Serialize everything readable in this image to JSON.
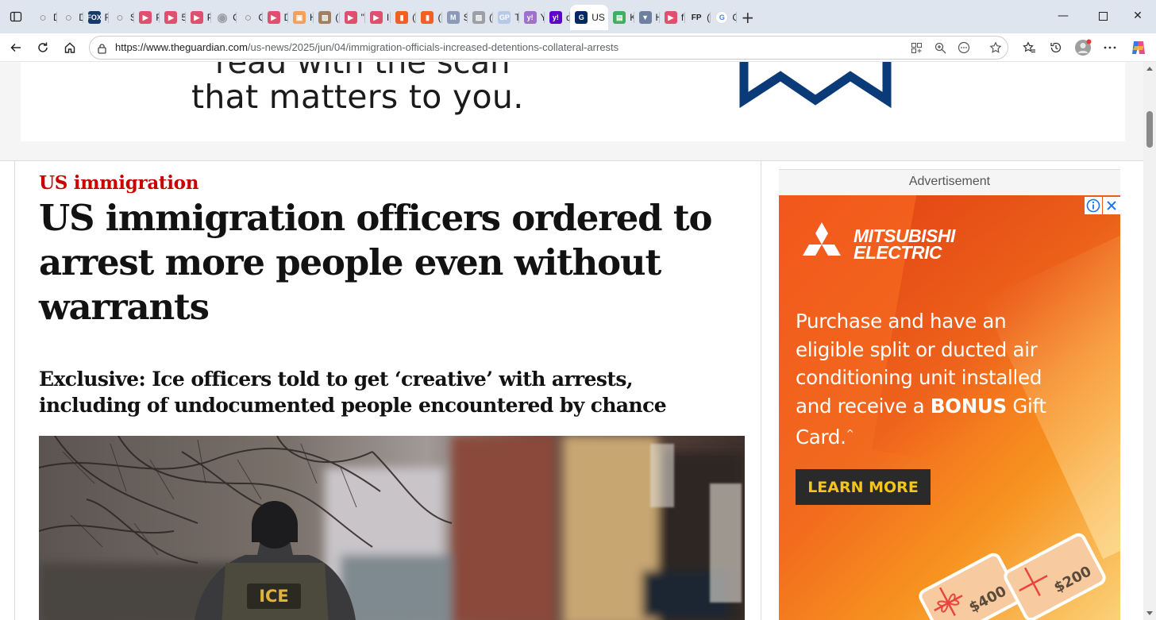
{
  "browser": {
    "tabs": [
      {
        "label": "Dr",
        "icon": "globe-icon",
        "color": "#7a7a7a"
      },
      {
        "label": "Dr",
        "icon": "globe-icon",
        "color": "#7a7a7a"
      },
      {
        "label": "Fo",
        "icon": "fox-news-icon",
        "color": "#183a6b"
      },
      {
        "label": "Sh",
        "icon": "globe-icon",
        "color": "#7a7a7a"
      },
      {
        "label": "Pe",
        "icon": "youtube-icon",
        "color": "#e0506e"
      },
      {
        "label": "50",
        "icon": "youtube-icon",
        "color": "#e0506e"
      },
      {
        "label": "Pe",
        "icon": "youtube-icon",
        "color": "#e0506e"
      },
      {
        "label": "Cc",
        "icon": "seal-icon",
        "color": "#9aa0a6"
      },
      {
        "label": "Cc",
        "icon": "globe-icon",
        "color": "#7a7a7a"
      },
      {
        "label": "De",
        "icon": "youtube-icon",
        "color": "#e0506e"
      },
      {
        "label": "Ha",
        "icon": "orange-box-icon",
        "color": "#f0a060"
      },
      {
        "label": "(1(",
        "icon": "image-icon",
        "color": "#a08060"
      },
      {
        "label": "\"Bl",
        "icon": "youtube-icon",
        "color": "#e0506e"
      },
      {
        "label": "In",
        "icon": "youtube-icon",
        "color": "#e0506e"
      },
      {
        "label": "(1(",
        "icon": "bookmark-orange-icon",
        "color": "#f06020"
      },
      {
        "label": "(1(",
        "icon": "bookmark-orange-icon",
        "color": "#f06020"
      },
      {
        "label": "Sh",
        "icon": "m-letter-icon",
        "color": "#8a9ab8"
      },
      {
        "label": "(1(",
        "icon": "image-icon",
        "color": "#9aa0a6"
      },
      {
        "label": "Th",
        "icon": "gp-icon",
        "color": "#b8c8e8"
      },
      {
        "label": "Ya",
        "icon": "yahoo-icon",
        "color": "#a070d0"
      },
      {
        "label": "dr",
        "icon": "yahoo-icon",
        "color": "#6001d2"
      },
      {
        "label": "US",
        "icon": "guardian-icon",
        "color": "#052962",
        "active": true
      },
      {
        "label": "Kii",
        "icon": "green-doc-icon",
        "color": "#40b060"
      },
      {
        "label": "Ha",
        "icon": "shield-badge-icon",
        "color": "#7080a0"
      },
      {
        "label": "fit",
        "icon": "youtube-icon",
        "color": "#e0506e"
      },
      {
        "label": "(1(",
        "icon": "fp-icon",
        "color": "#222222"
      },
      {
        "label": "Gr",
        "icon": "google-icon",
        "color": "#ffffff"
      }
    ],
    "url_host": "https://www.theguardian.com",
    "url_path": "/us-news/2025/jun/04/immigration-officials-increased-detentions-collateral-arrests"
  },
  "top_ad": {
    "cut_line": "read with the scan",
    "line": "that matters to you."
  },
  "article": {
    "kicker": "US immigration",
    "headline": "US immigration officers ordered to arrest more people even without warrants",
    "standfirst": "Exclusive: Ice officers told to get ‘creative’ with arrests, including of undocumented people encountered by chance",
    "photo_vest_text": "ICE"
  },
  "side_ad": {
    "label": "Advertisement",
    "brand_line1": "MITSUBISHI",
    "brand_line2": "ELECTRIC",
    "copy_before": "Purchase and have an eligible split or ducted air conditioning unit installed and receive a ",
    "copy_bold": "BONUS",
    "copy_after": " Gift Card.",
    "copy_sup": "^",
    "cta": "LEARN MORE",
    "gift1": "$400",
    "gift2": "$200"
  },
  "colors": {
    "kicker": "#c70000",
    "ad_orange": "#f2571c",
    "cta_text": "#f5c518"
  }
}
